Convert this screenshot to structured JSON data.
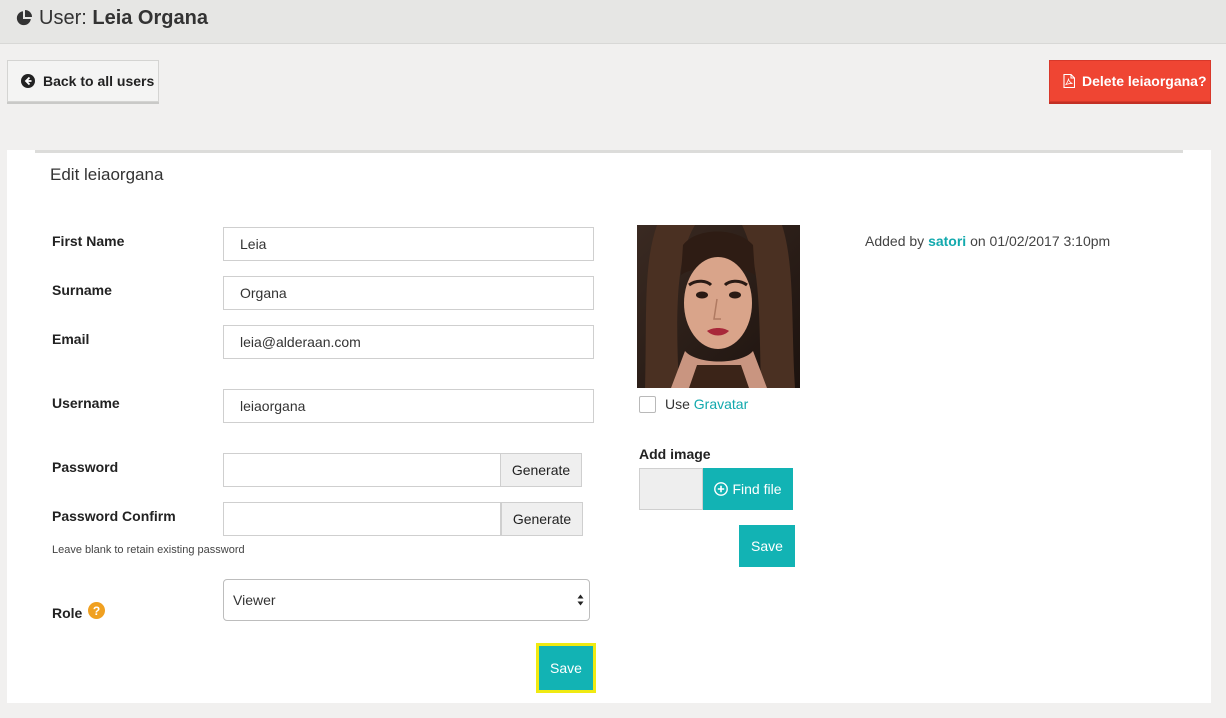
{
  "header": {
    "title_prefix": "User:",
    "title_name": "Leia Organa"
  },
  "actions": {
    "back_label": "Back to all users",
    "delete_label": "Delete leiaorgana?"
  },
  "panel": {
    "title": "Edit leiaorgana"
  },
  "form": {
    "first_name_label": "First Name",
    "first_name_value": "Leia",
    "surname_label": "Surname",
    "surname_value": "Organa",
    "email_label": "Email",
    "email_value": "leia@alderaan.com",
    "username_label": "Username",
    "username_value": "leiaorgana",
    "password_label": "Password",
    "password_confirm_label": "Password Confirm",
    "generate_label": "Generate",
    "password_hint": "Leave blank to retain existing password",
    "role_label": "Role",
    "role_value": "Viewer",
    "save_label": "Save"
  },
  "image": {
    "use_label": "Use",
    "gravatar_link": "Gravatar",
    "add_image_label": "Add image",
    "find_file_label": "Find file",
    "save_label": "Save"
  },
  "meta": {
    "added_by_prefix": "Added by",
    "added_by_user": "satori",
    "added_on": "on 01/02/2017 3:10pm"
  },
  "colors": {
    "accent": "#12b3b4",
    "danger": "#ef4533",
    "help": "#f0a020",
    "highlight": "#f0ea12"
  },
  "icons": {
    "page": "pie-chart-icon",
    "back": "arrow-circle-left-icon",
    "delete": "pdf-file-icon",
    "help": "question-circle-icon",
    "find_file": "plus-circle-icon",
    "select": "updown-caret-icon"
  }
}
